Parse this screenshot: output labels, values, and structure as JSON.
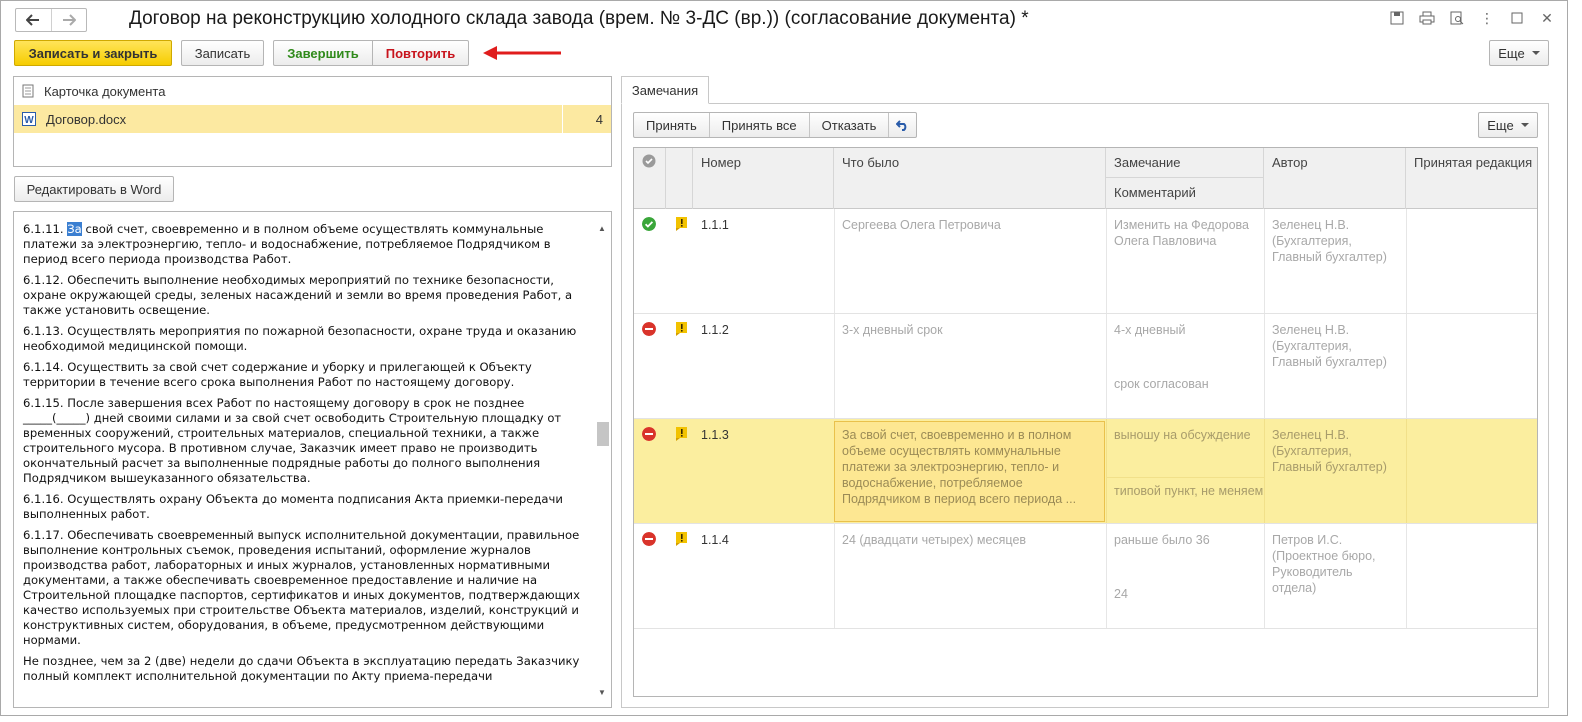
{
  "window": {
    "title": "Договор на реконструкцию холодного склада завода (врем. № 3-ДС (вр.)) (согласование документа) *"
  },
  "toolbar": {
    "save_close": "Записать и закрыть",
    "save": "Записать",
    "finish": "Завершить",
    "repeat": "Повторить",
    "more": "Еще"
  },
  "files": [
    {
      "label": "Карточка документа",
      "icon": "document-icon",
      "count": ""
    },
    {
      "label": "Договор.docx",
      "icon": "word-icon",
      "count": "4"
    }
  ],
  "edit_word_button": "Редактировать в Word",
  "document_text": {
    "p1_highlight": "За",
    "p1_prefix": "6.1.11. ",
    "p1_rest": " свой счет, своевременно и в полном объеме осуществлять коммунальные платежи за электроэнергию, тепло- и водоснабжение, потребляемое Подрядчиком в период всего периода производства Работ.",
    "paragraphs": [
      "6.1.12. Обеспечить выполнение необходимых мероприятий по технике безопасности, охране окружающей среды, зеленых насаждений и земли во время проведения Работ, а также установить освещение.",
      "6.1.13. Осуществлять мероприятия по пожарной безопасности, охране труда и оказанию необходимой медицинской помощи.",
      "6.1.14. Осуществить за свой счет содержание и уборку и прилегающей к Объекту территории в течение всего срока выполнения Работ по настоящему договору.",
      "6.1.15. После завершения всех Работ по настоящему договору в срок не позднее _____(_____) дней своими силами и за свой счет освободить Строительную площадку от временных сооружений, строительных материалов, специальной техники, а также строительного мусора. В противном случае, Заказчик имеет право не производить окончательный расчет за выполненные подрядные работы до полного выполнения Подрядчиком вышеуказанного обязательства.",
      "6.1.16. Осуществлять охрану Объекта до момента подписания Акта приемки-передачи выполненных работ.",
      "6.1.17. Обеспечивать своевременный выпуск исполнительной документации, правильное выполнение контрольных съемок, проведения испытаний, оформление журналов производства работ, лабораторных и иных журналов, установленных нормативными документами, а также обеспечивать своевременное предоставление и наличие на Строительной площадке паспортов, сертификатов и иных документов, подтверждающих качество используемых при строительстве Объекта материалов, изделий, конструкций и конструктивных систем, оборудования, в объеме, предусмотренном действующими нормами.",
      "Не позднее, чем за 2 (две) недели до сдачи Объекта в эксплуатацию передать Заказчику полный комплект исполнительной документации по Акту приема-передачи"
    ]
  },
  "remarks_tab": "Замечания",
  "remarks_toolbar": {
    "accept": "Принять",
    "accept_all": "Принять все",
    "reject": "Отказать",
    "undo_icon": "undo-icon",
    "more": "Еще"
  },
  "grid": {
    "headers": {
      "number": "Номер",
      "was": "Что было",
      "remark": "Замечание",
      "comment": "Комментарий",
      "author": "Автор",
      "accepted": "Принятая редакция"
    },
    "rows": [
      {
        "status": "accepted",
        "number": "1.1.1",
        "was": "Сергеева Олега Петровича",
        "remark": "Изменить на Федорова Олега Павловича",
        "comment": "",
        "author": "Зеленец Н.В. (Бухгалтерия, Главный бухгалтер)",
        "accepted": ""
      },
      {
        "status": "rejected",
        "number": "1.1.2",
        "was": "3-х дневный срок",
        "remark": "4-х дневный",
        "comment": "срок согласован",
        "author": "Зеленец Н.В. (Бухгалтерия, Главный бухгалтер)",
        "accepted": ""
      },
      {
        "status": "rejected",
        "number": "1.1.3",
        "was": "За свой счет, своевременно и в полном объеме осуществлять коммунальные платежи за электроэнергию, тепло- и водоснабжение, потребляемое Подрядчиком в  период всего периода ...",
        "remark": "выношу на обсуждение",
        "comment": "типовой пункт, не меняем",
        "author": "Зеленец Н.В. (Бухгалтерия, Главный бухгалтер)",
        "accepted": ""
      },
      {
        "status": "rejected",
        "number": "1.1.4",
        "was": "24 (двадцати четырех) месяцев",
        "remark": "раньше было 36",
        "comment": "24",
        "author": "Петров И.С. (Проектное бюро, Руководитель отдела)",
        "accepted": ""
      }
    ]
  },
  "colors": {
    "accent_yellow": "#f6cd00",
    "selection_yellow": "#fbee9f",
    "accepted_green": "#3aa63a",
    "rejected_red": "#d9342b",
    "flag_yellow": "#f2c200",
    "repeat_red": "#c8141d",
    "finish_green": "#2f8a1a"
  }
}
